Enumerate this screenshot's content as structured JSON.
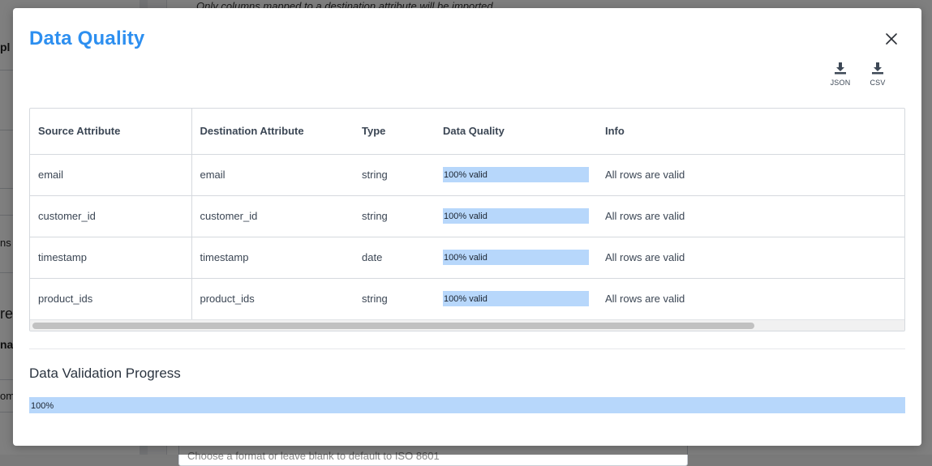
{
  "background": {
    "top_hint": "Only columns mapped to a destination attribute will be imported",
    "left_fragments": [
      "pl",
      "ns",
      "re",
      "nai",
      "om"
    ],
    "input_placeholder": "Choose a format or leave blank to default to ISO 8601"
  },
  "modal": {
    "title": "Data Quality",
    "downloads": [
      {
        "label": "JSON",
        "icon": "download-icon"
      },
      {
        "label": "CSV",
        "icon": "download-icon"
      }
    ],
    "table": {
      "headers": [
        "Source Attribute",
        "Destination Attribute",
        "Type",
        "Data Quality",
        "Info"
      ],
      "rows": [
        {
          "source": "email",
          "destination": "email",
          "type": "string",
          "quality_label": "100% valid",
          "quality_fraction": 1.0,
          "info": "All rows are valid"
        },
        {
          "source": "customer_id",
          "destination": "customer_id",
          "type": "string",
          "quality_label": "100% valid",
          "quality_fraction": 1.0,
          "info": "All rows are valid"
        },
        {
          "source": "timestamp",
          "destination": "timestamp",
          "type": "date",
          "quality_label": "100% valid",
          "quality_fraction": 1.0,
          "info": "All rows are valid"
        },
        {
          "source": "product_ids",
          "destination": "product_ids",
          "type": "string",
          "quality_label": "100% valid",
          "quality_fraction": 1.0,
          "info": "All rows are valid"
        }
      ]
    },
    "progress": {
      "title": "Data Validation Progress",
      "label": "100%",
      "fraction": 1.0
    }
  },
  "colors": {
    "title": "#2d8ff0",
    "bar_fill": "#b7d7fb"
  }
}
